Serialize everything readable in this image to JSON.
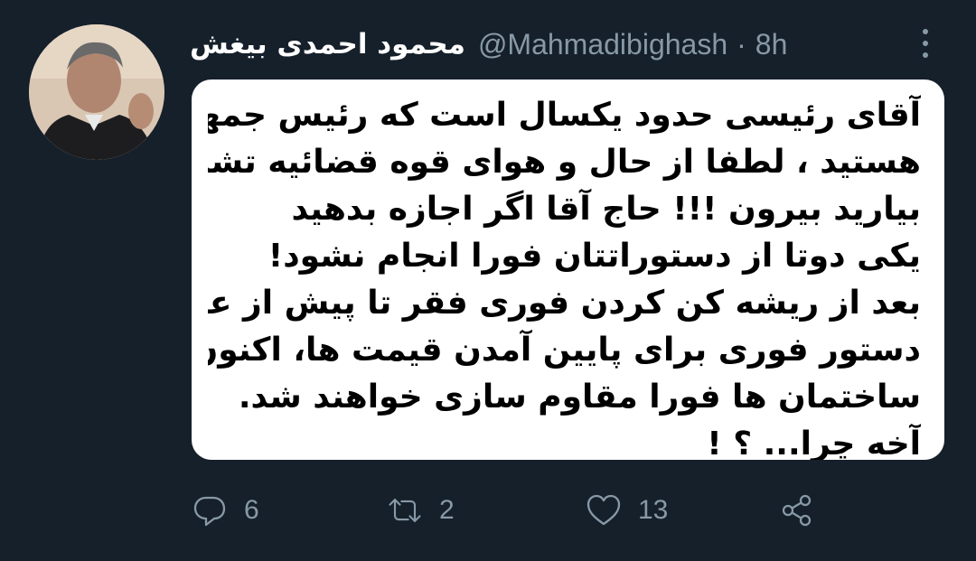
{
  "tweet": {
    "author": {
      "display_name": "محمود احمدی بیغش",
      "handle": "@Mahmadibighash",
      "separator": "·",
      "time": "8h"
    },
    "image_text_lines": [
      "آقای رئیسی حدود  یکسال است که رئیس جمهور",
      "هستید ، لطفا از حال و هوای قوه قضائیه تشریف",
      "بیارید بیرون !!! حاج آقا اگر اجازه بدهید",
      "یکی دوتا از دستوراتتان فورا انجام نشود!",
      "بعد از ریشه کن کردن فوری فقر تا پیش از عید و",
      "دستور فوری برای پایین آمدن قیمت ها، اکنون",
      "ساختمان ها فورا مقاوم سازی خواهند شد.",
      "آخه چرا... ؟ !"
    ],
    "actions": {
      "reply_count": "6",
      "retweet_count": "2",
      "like_count": "13"
    },
    "icons": {
      "avatar": "avatar-photo",
      "more": "more-vertical-icon",
      "reply": "reply-icon",
      "retweet": "retweet-icon",
      "like": "heart-icon",
      "share": "share-icon"
    },
    "colors": {
      "background": "#15202b",
      "secondary_text": "#8899a6",
      "primary_text": "#ffffff",
      "media_background": "#ffffff",
      "media_text": "#000000"
    }
  }
}
